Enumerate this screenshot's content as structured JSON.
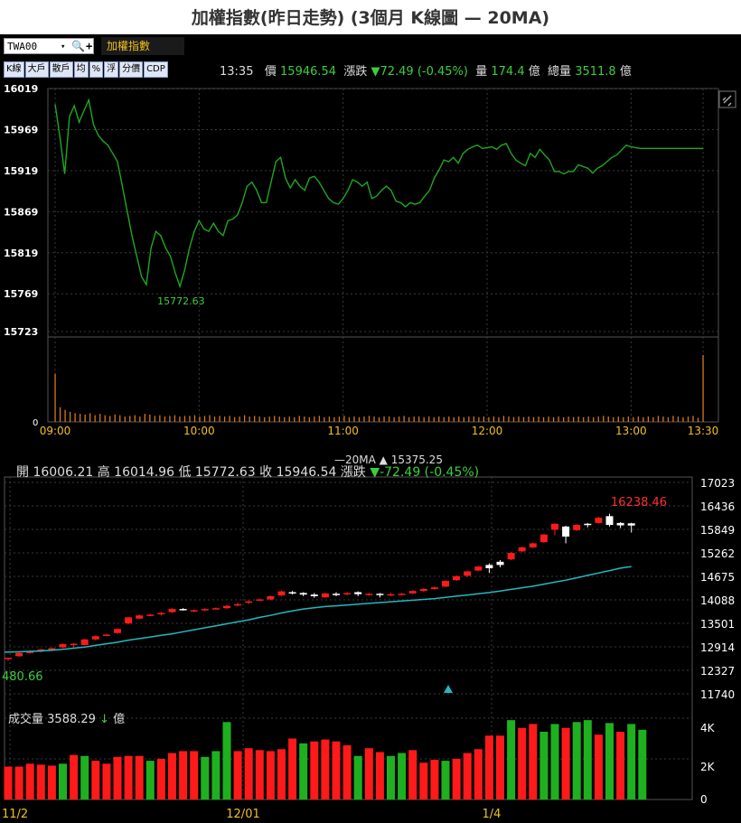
{
  "title": "加權指數(昨日走勢) (3個月 K線圖  — 20MA)",
  "toolbar": {
    "symbol": "TWA00",
    "dropdown_icon": "▾",
    "search_icon": "🔍",
    "plus": "+",
    "index_name": "加權指數",
    "buttons": [
      "K線",
      "大戶",
      "散戶",
      "均",
      "%",
      "浮",
      "分價",
      "CDP"
    ]
  },
  "quote": {
    "time": "13:35",
    "price_label": "價",
    "price": "15946.54",
    "change_label": "漲跌",
    "change": "▼72.49 (-0.45%)",
    "volume_label": "量",
    "volume": "174.4",
    "volume_unit": "億",
    "total_label": "總量",
    "total": "3511.8",
    "total_unit": "億"
  },
  "colors": {
    "line": "#1fa81f",
    "up": "#ff1a1a",
    "down": "#1fb01f",
    "ma": "#23b8c0",
    "grid": "#3a3a3a",
    "axis_text": "#ffffff",
    "vol_intraday": "#d8781a"
  },
  "chart_data": [
    {
      "type": "line",
      "title": "",
      "x_ticks": [
        "09:00",
        "10:00",
        "11:00",
        "12:00",
        "13:00",
        "13:30"
      ],
      "y_ticks": [
        16019,
        15969,
        15919,
        15869,
        15819,
        15769,
        15723
      ],
      "ylim": [
        15723,
        16019
      ],
      "low_label": "15772.63",
      "x_minutes": [
        0,
        2,
        4,
        6,
        8,
        10,
        12,
        14,
        16,
        18,
        20,
        22,
        24,
        26,
        28,
        30,
        32,
        34,
        36,
        38,
        40,
        42,
        44,
        46,
        48,
        50,
        52,
        54,
        56,
        58,
        60,
        62,
        64,
        66,
        68,
        70,
        72,
        74,
        76,
        78,
        80,
        82,
        84,
        86,
        88,
        90,
        92,
        94,
        96,
        98,
        100,
        102,
        104,
        106,
        108,
        110,
        112,
        114,
        116,
        118,
        120,
        122,
        124,
        126,
        128,
        130,
        132,
        134,
        136,
        138,
        140,
        142,
        144,
        146,
        148,
        150,
        152,
        154,
        156,
        158,
        160,
        162,
        164,
        166,
        168,
        170,
        172,
        174,
        176,
        178,
        180,
        182,
        184,
        186,
        188,
        190,
        192,
        194,
        196,
        198,
        200,
        202,
        204,
        206,
        208,
        210,
        212,
        214,
        216,
        218,
        220,
        222,
        224,
        226,
        228,
        230,
        232,
        234,
        236,
        238,
        240,
        242,
        244,
        246,
        248,
        250,
        252,
        254,
        256,
        258,
        260,
        262,
        264,
        266,
        268,
        270
      ],
      "values": [
        16000,
        15960,
        15915,
        15985,
        15998,
        15978,
        15992,
        16005,
        15975,
        15962,
        15955,
        15950,
        15940,
        15930,
        15900,
        15870,
        15840,
        15815,
        15790,
        15780,
        15825,
        15845,
        15840,
        15825,
        15815,
        15795,
        15778,
        15798,
        15825,
        15845,
        15858,
        15848,
        15845,
        15855,
        15845,
        15840,
        15858,
        15860,
        15865,
        15880,
        15900,
        15905,
        15895,
        15880,
        15880,
        15905,
        15930,
        15935,
        15910,
        15898,
        15908,
        15900,
        15895,
        15910,
        15912,
        15905,
        15895,
        15885,
        15880,
        15878,
        15885,
        15895,
        15908,
        15905,
        15900,
        15905,
        15885,
        15888,
        15895,
        15900,
        15895,
        15882,
        15880,
        15875,
        15880,
        15878,
        15880,
        15888,
        15895,
        15910,
        15920,
        15932,
        15930,
        15935,
        15928,
        15940,
        15945,
        15948,
        15950,
        15946,
        15947,
        15948,
        15945,
        15950,
        15952,
        15940,
        15932,
        15928,
        15925,
        15940,
        15935,
        15945,
        15938,
        15932,
        15918,
        15918,
        15915,
        15918,
        15918,
        15926,
        15924,
        15922,
        15916,
        15922,
        15925,
        15930,
        15935,
        15938,
        15944,
        15950,
        15948,
        15947,
        15946,
        15946,
        15946,
        15946,
        15946,
        15946,
        15946,
        15946,
        15946,
        15946,
        15946,
        15946,
        15946,
        15946
      ],
      "volume_bars": [
        72,
        22,
        18,
        15,
        13,
        12,
        11,
        13,
        10,
        12,
        10,
        9,
        11,
        10,
        8,
        9,
        10,
        8,
        12,
        11,
        9,
        10,
        8,
        9,
        10,
        8,
        9,
        9,
        10,
        8,
        9,
        10,
        8,
        9,
        8,
        9,
        7,
        8,
        10,
        8,
        9,
        8,
        7,
        8,
        9,
        8,
        7,
        8,
        7,
        9,
        8,
        7,
        8,
        9,
        7,
        8,
        7,
        8,
        9,
        7,
        8,
        7,
        8,
        9,
        8,
        7,
        8,
        8,
        7,
        8,
        9,
        7,
        8,
        8,
        7,
        8,
        7,
        8,
        7,
        8,
        7,
        8,
        7,
        8,
        8,
        7,
        8,
        7,
        8,
        7,
        9,
        8,
        7,
        8,
        7,
        8,
        7,
        8,
        7,
        8,
        7,
        8,
        7,
        8,
        7,
        8,
        7,
        8,
        7,
        8,
        9,
        8,
        7,
        8,
        7,
        8,
        7,
        8,
        7,
        8,
        7,
        9,
        8,
        7,
        9,
        8,
        7,
        8,
        9,
        6,
        100
      ],
      "volume_zero": "0"
    },
    {
      "type": "candlestick",
      "title": "",
      "header": {
        "open_label": "開",
        "open": "16006.21",
        "high_label": "高",
        "high": "16014.96",
        "low_label": "低",
        "low": "15772.63",
        "close_label": "收",
        "close": "15946.54",
        "change_label": "漲跌",
        "change": "▼-72.49 (-0.45%)"
      },
      "ma_label": "—20MA ▲ 15375.25",
      "y_ticks": [
        17023,
        16436,
        15849,
        15262,
        14675,
        14088,
        13501,
        12914,
        12327,
        11740
      ],
      "ylim": [
        11740,
        17023
      ],
      "x_labels": [
        "11/2",
        "12/01",
        "1/4"
      ],
      "high_mark": "16238.46",
      "low_mark": "480.66",
      "candles": [
        [
          12610,
          12640,
          12560,
          12650
        ],
        [
          12680,
          12760,
          12660,
          12780
        ],
        [
          12760,
          12810,
          12740,
          12830
        ],
        [
          12800,
          12850,
          12780,
          12870
        ],
        [
          12830,
          12880,
          12810,
          12900
        ],
        [
          12900,
          12980,
          12880,
          13000
        ],
        [
          12980,
          12990,
          12900,
          13010
        ],
        [
          12960,
          13100,
          12950,
          13110
        ],
        [
          13100,
          13180,
          13080,
          13200
        ],
        [
          13200,
          13220,
          13180,
          13240
        ],
        [
          13260,
          13360,
          13240,
          13380
        ],
        [
          13500,
          13650,
          13480,
          13670
        ],
        [
          13620,
          13700,
          13600,
          13720
        ],
        [
          13700,
          13720,
          13680,
          13740
        ],
        [
          13740,
          13760,
          13700,
          13790
        ],
        [
          13780,
          13860,
          13760,
          13880
        ],
        [
          13860,
          13840,
          13820,
          13880
        ],
        [
          13820,
          13830,
          13780,
          13850
        ],
        [
          13830,
          13860,
          13800,
          13880
        ],
        [
          13860,
          13880,
          13850,
          13900
        ],
        [
          13880,
          13940,
          13860,
          13960
        ],
        [
          13950,
          13980,
          13920,
          14020
        ],
        [
          14020,
          14050,
          13980,
          14080
        ],
        [
          14080,
          14100,
          14060,
          14120
        ],
        [
          14100,
          14180,
          14080,
          14200
        ],
        [
          14200,
          14300,
          14180,
          14320
        ],
        [
          14280,
          14260,
          14220,
          14310
        ],
        [
          14260,
          14220,
          14180,
          14280
        ],
        [
          14220,
          14180,
          14140,
          14260
        ],
        [
          14150,
          14250,
          14140,
          14270
        ],
        [
          14240,
          14230,
          14180,
          14280
        ],
        [
          14230,
          14260,
          14200,
          14280
        ],
        [
          14280,
          14230,
          14180,
          14300
        ],
        [
          14230,
          14240,
          14190,
          14260
        ],
        [
          14240,
          14210,
          14150,
          14260
        ],
        [
          14200,
          14230,
          14180,
          14260
        ],
        [
          14220,
          14240,
          14200,
          14260
        ],
        [
          14250,
          14310,
          14230,
          14330
        ],
        [
          14310,
          14360,
          14290,
          14380
        ],
        [
          14360,
          14400,
          14340,
          14420
        ],
        [
          14420,
          14560,
          14400,
          14580
        ],
        [
          14580,
          14680,
          14560,
          14700
        ],
        [
          14690,
          14800,
          14660,
          14820
        ],
        [
          14820,
          14920,
          14800,
          14940
        ],
        [
          14960,
          14880,
          14760,
          15000
        ],
        [
          15040,
          14960,
          14900,
          15080
        ],
        [
          15100,
          15260,
          15080,
          15280
        ],
        [
          15300,
          15400,
          15280,
          15420
        ],
        [
          15400,
          15500,
          15380,
          15520
        ],
        [
          15530,
          15720,
          15510,
          15740
        ],
        [
          15840,
          15990,
          15700,
          16000
        ],
        [
          15920,
          15670,
          15500,
          15940
        ],
        [
          15830,
          15960,
          15810,
          15980
        ],
        [
          15990,
          15980,
          15900,
          16010
        ],
        [
          16010,
          16140,
          15990,
          16160
        ],
        [
          16180,
          15960,
          15920,
          16240
        ],
        [
          16010,
          15950,
          15880,
          16030
        ],
        [
          16000,
          15946,
          15770,
          16015
        ]
      ],
      "ma20": [
        12780,
        12790,
        12800,
        12810,
        12830,
        12850,
        12880,
        12910,
        12950,
        12990,
        13030,
        13080,
        13120,
        13160,
        13200,
        13240,
        13290,
        13340,
        13390,
        13440,
        13490,
        13540,
        13590,
        13650,
        13700,
        13760,
        13810,
        13860,
        13890,
        13920,
        13940,
        13960,
        13980,
        14000,
        14020,
        14040,
        14060,
        14080,
        14100,
        14120,
        14150,
        14180,
        14210,
        14240,
        14270,
        14310,
        14350,
        14390,
        14430,
        14480,
        14530,
        14580,
        14640,
        14700,
        14760,
        14820,
        14880,
        14920
      ],
      "volume_label": "成交量",
      "volume_value": "3588.29",
      "volume_arrow": "↓",
      "volume_unit": "億",
      "volume_ticks": [
        "4K",
        "2K",
        "0"
      ],
      "volume": [
        1700,
        1700,
        1850,
        1800,
        1750,
        1850,
        2300,
        2250,
        2000,
        1850,
        2200,
        2250,
        2250,
        2000,
        2100,
        2400,
        2500,
        2500,
        2200,
        2500,
        4000,
        2500,
        2650,
        2550,
        2500,
        2600,
        3150,
        2900,
        3000,
        3100,
        3000,
        2800,
        2250,
        2650,
        2450,
        2250,
        2400,
        2550,
        1900,
        2050,
        2000,
        2100,
        2400,
        2600,
        3300,
        3300,
        4100,
        3700,
        3900,
        3500,
        3900,
        3700,
        4000,
        4100,
        3350,
        3950,
        3500,
        3900,
        3600
      ],
      "volume_up": [
        true,
        true,
        true,
        true,
        true,
        false,
        true,
        false,
        true,
        true,
        true,
        true,
        true,
        false,
        true,
        true,
        true,
        true,
        false,
        false,
        false,
        true,
        true,
        true,
        true,
        true,
        true,
        false,
        true,
        true,
        true,
        true,
        false,
        true,
        true,
        false,
        false,
        true,
        true,
        true,
        false,
        true,
        true,
        true,
        true,
        true,
        false,
        true,
        true,
        false,
        false,
        true,
        false,
        false,
        true,
        false,
        true,
        false,
        false
      ]
    }
  ]
}
